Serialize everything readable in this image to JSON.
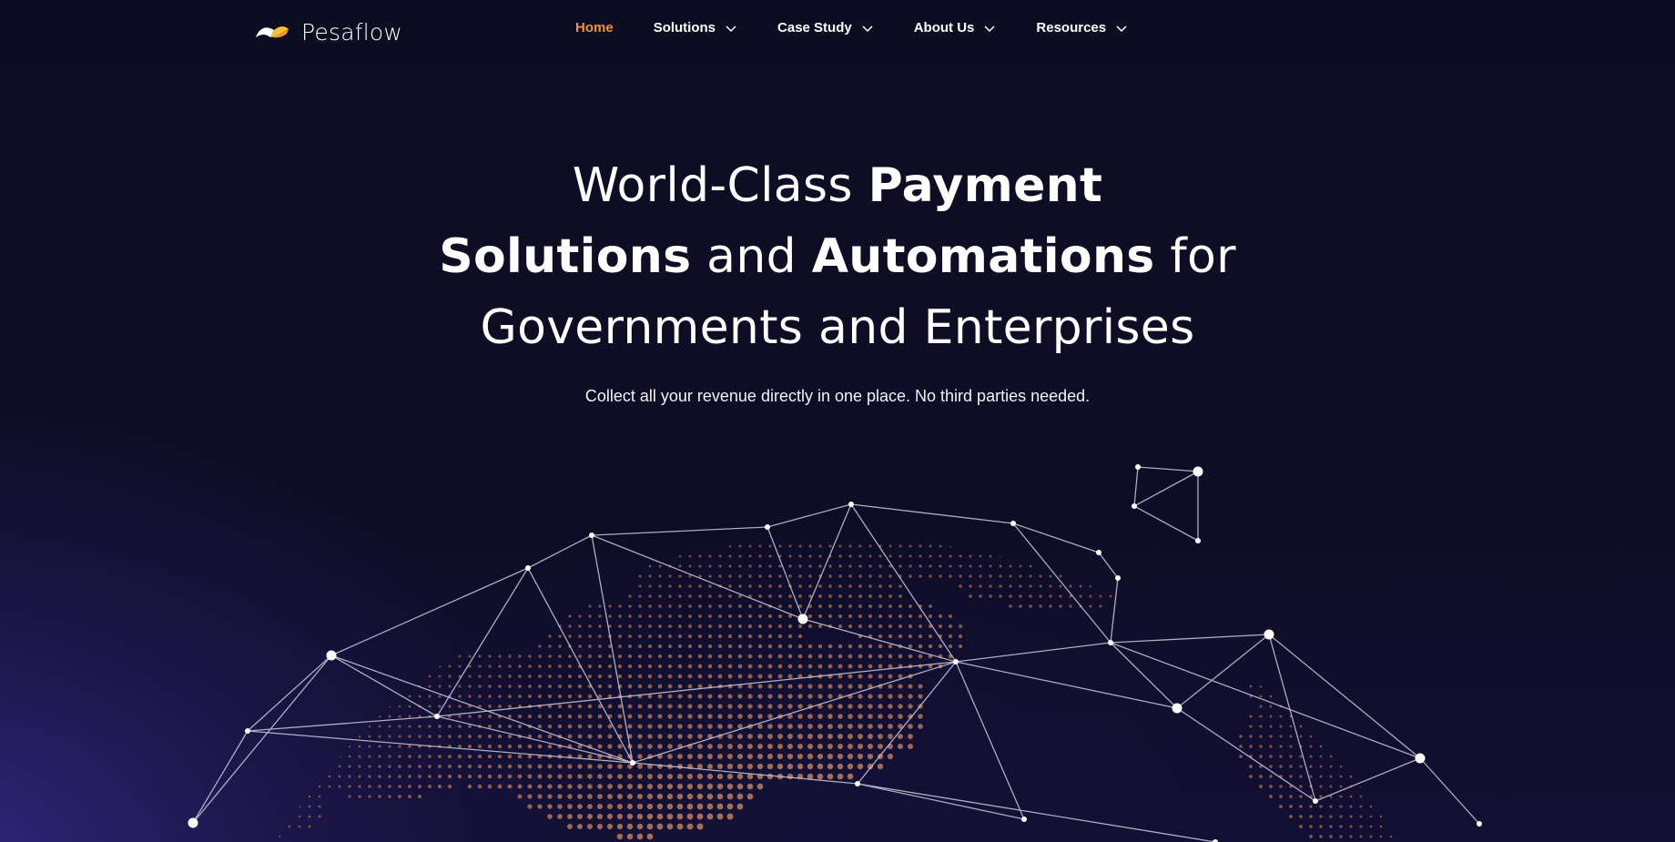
{
  "brand": {
    "name": "Pesaflow",
    "accent": "#f0923d",
    "logo_colors": [
      "#ffffff",
      "#f5c230",
      "#f0923d"
    ]
  },
  "nav": {
    "items": [
      {
        "label": "Home",
        "active": true,
        "has_dropdown": false
      },
      {
        "label": "Solutions",
        "active": false,
        "has_dropdown": true
      },
      {
        "label": "Case Study",
        "active": false,
        "has_dropdown": true
      },
      {
        "label": "About Us",
        "active": false,
        "has_dropdown": true
      },
      {
        "label": "Resources",
        "active": false,
        "has_dropdown": true
      }
    ],
    "dropdown_icon": "chevron-down-icon"
  },
  "hero": {
    "line1_light": "World-Class ",
    "line1_bold": "Payment",
    "line2_bold_a": "Solutions",
    "line2_light_a": " and ",
    "line2_bold_b": "Automations",
    "line2_light_b": " for",
    "line3": "Governments and Enterprises",
    "subtitle": "Collect all your revenue directly in one place. No third parties needed."
  },
  "illustration": {
    "name": "network-globe-graphic",
    "dot_color": "#f0a066",
    "line_color": "#c8c8d8"
  }
}
